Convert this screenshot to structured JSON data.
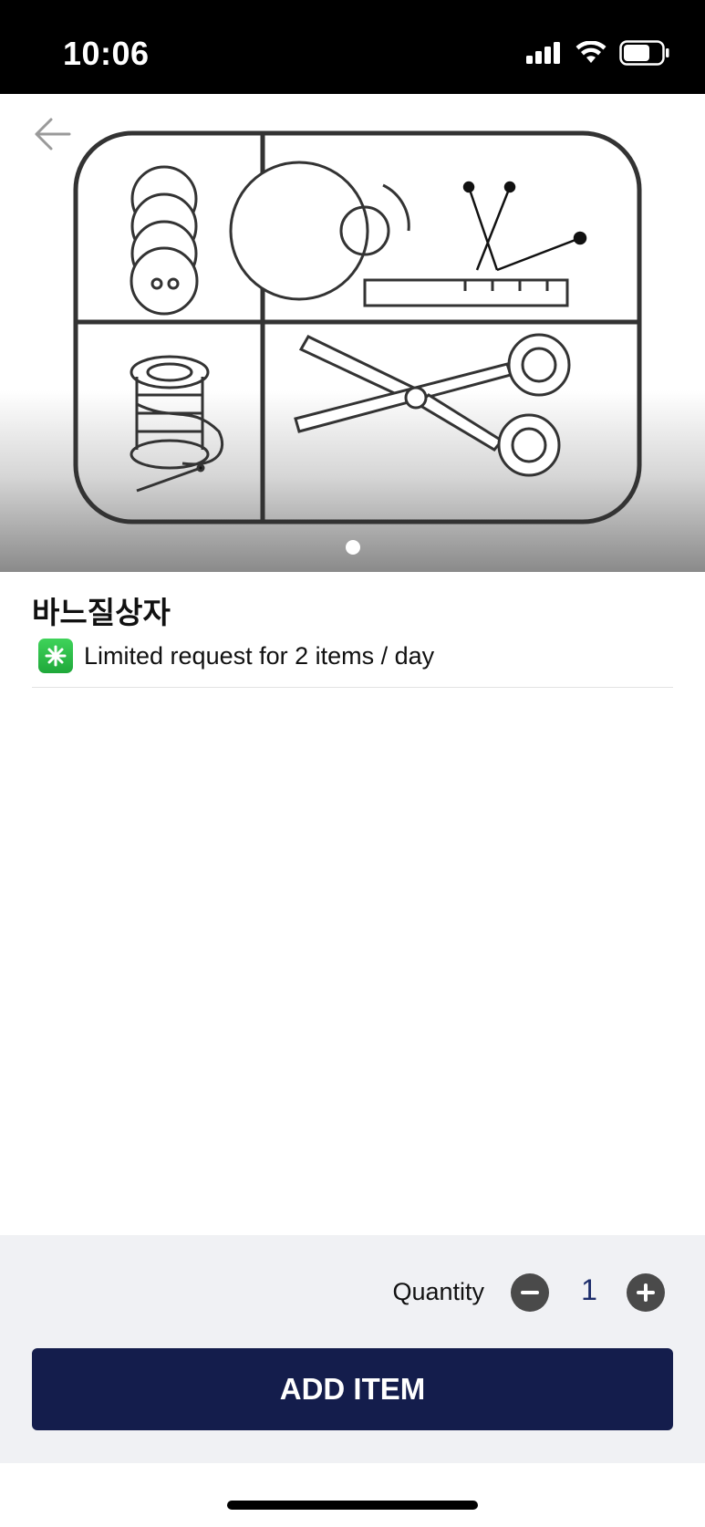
{
  "status_bar": {
    "time": "10:06"
  },
  "product": {
    "title": "바느질상자",
    "limit_text": "Limited request for 2 items / day",
    "image_count": 1,
    "current_image": 1
  },
  "quantity": {
    "label": "Quantity",
    "value": "1"
  },
  "actions": {
    "add_item_label": "ADD ITEM"
  },
  "icons": {
    "back": "back-arrow-icon",
    "limit": "asterisk-badge-icon",
    "minus": "minus-circle-icon",
    "plus": "plus-circle-icon"
  },
  "colors": {
    "accent": "#141d4c",
    "quantity_value": "#1d2d6b",
    "limit_badge": "#2cc04a"
  }
}
